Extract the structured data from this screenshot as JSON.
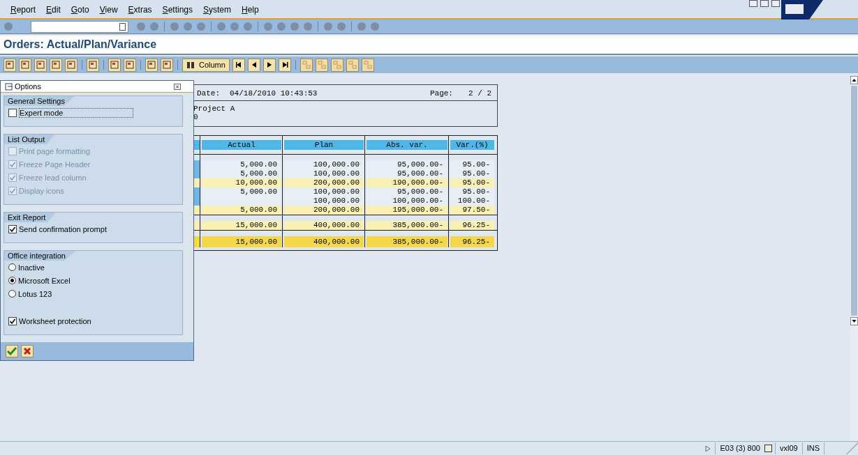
{
  "menu": [
    "Report",
    "Edit",
    "Goto",
    "View",
    "Extras",
    "Settings",
    "System",
    "Help"
  ],
  "title": "Orders: Actual/Plan/Variance",
  "app_toolbar": {
    "column_button": "Column"
  },
  "dialog": {
    "title": "Options",
    "groups": [
      {
        "title": "General Settings",
        "items": [
          {
            "kind": "checkbox",
            "label": "Expert mode",
            "checked": false,
            "disabled": false,
            "focused": true
          }
        ]
      },
      {
        "title": "List Output",
        "items": [
          {
            "kind": "checkbox",
            "label": "Print page formatting",
            "checked": false,
            "disabled": true
          },
          {
            "kind": "checkbox",
            "label": "Freeze Page Header",
            "checked": true,
            "disabled": true
          },
          {
            "kind": "checkbox",
            "label": "Freeze lead column",
            "checked": true,
            "disabled": true
          },
          {
            "kind": "checkbox",
            "label": "Display icons",
            "checked": true,
            "disabled": true
          }
        ]
      },
      {
        "title": "Exit Report",
        "items": [
          {
            "kind": "checkbox",
            "label": "Send confirmation prompt",
            "checked": true,
            "disabled": false
          }
        ]
      },
      {
        "title": "Office integration",
        "items": [
          {
            "kind": "radio",
            "label": "Inactive",
            "selected": false,
            "disabled": false
          },
          {
            "kind": "radio",
            "label": "Microsoft Excel",
            "selected": true,
            "disabled": false
          },
          {
            "kind": "radio",
            "label": "Lotus 123",
            "selected": false,
            "disabled": false
          },
          {
            "kind": "checkbox",
            "label": "Worksheet protection",
            "checked": true,
            "disabled": false
          }
        ]
      }
    ]
  },
  "report": {
    "date_label": "Date:",
    "date": "04/18/2010 10:43:53",
    "page_label": "Page:",
    "page": "2 /   2",
    "header_lines": [
      "Project A",
      "0"
    ],
    "columns": [
      "Actual",
      "Plan",
      "Abs. var.",
      "Var.(%)"
    ],
    "rows": [
      {
        "kind": "item",
        "cells": [
          "5,000.00",
          "100,000.00",
          "95,000.00-",
          "95.00-"
        ]
      },
      {
        "kind": "item",
        "cells": [
          "5,000.00",
          "100,000.00",
          "95,000.00-",
          "95.00-"
        ]
      },
      {
        "kind": "subtotal",
        "cells": [
          "10,000.00",
          "200,000.00",
          "190,000.00-",
          "95.00-"
        ]
      },
      {
        "kind": "item",
        "cells": [
          "5,000.00",
          "100,000.00",
          "95,000.00-",
          "95.00-"
        ]
      },
      {
        "kind": "item",
        "cells": [
          "",
          "100,000.00",
          "100,000.00-",
          "100.00-"
        ]
      },
      {
        "kind": "subtotal",
        "cells": [
          "5,000.00",
          "200,000.00",
          "195,000.00-",
          "97.50-"
        ]
      },
      {
        "kind": "subtotal",
        "block": true,
        "cells": [
          "15,000.00",
          "400,000.00",
          "385,000.00-",
          "96.25-"
        ]
      },
      {
        "kind": "total",
        "block": true,
        "cells": [
          "15,000.00",
          "400,000.00",
          "385,000.00-",
          "96.25-"
        ]
      }
    ]
  },
  "status_bar": {
    "system": "E03 (3) 800",
    "server": "vxl09",
    "mode": "INS"
  }
}
